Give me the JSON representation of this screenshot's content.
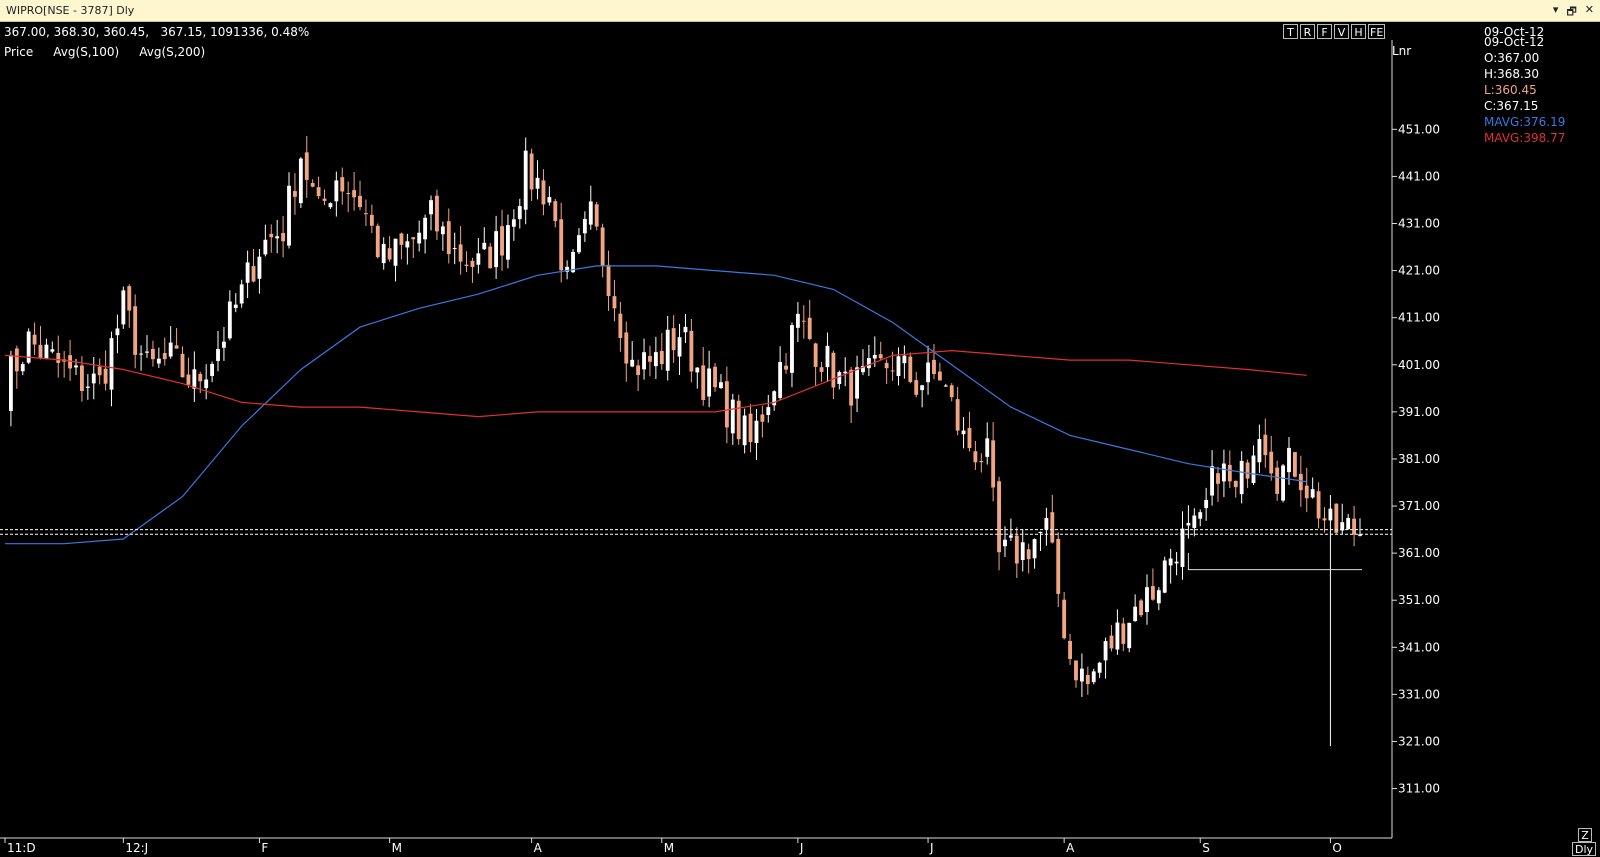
{
  "window": {
    "title": "WIPRO[NSE - 3787] Dly",
    "controls": [
      "▾",
      "🗗",
      "✕"
    ]
  },
  "header": {
    "info": "367.00, 368.30, 360.45,   367.15, 1091336, 0.48%",
    "legend": [
      "Price",
      "Avg(S,100)",
      "Avg(S,200)"
    ],
    "tool_buttons": [
      "T",
      "R",
      "F",
      "V",
      "H",
      "FE"
    ],
    "scale_type": "Lnr"
  },
  "readout": {
    "date1": "09-Oct-12",
    "date2": "09-Oct-12",
    "open": "O:367.00",
    "high": "H:368.30",
    "low": "L:360.45",
    "close": "C:367.15",
    "mavg1": "MAVG:376.19",
    "mavg2": "MAVG:398.77",
    "colors": {
      "low": "#f2a583",
      "mavg1": "#3a78e0",
      "mavg2": "#e03030"
    }
  },
  "corner": {
    "zoom": "Z",
    "period": "Dly"
  },
  "chart_data": {
    "type": "candlestick",
    "y_ticks": [
      451,
      441,
      431,
      421,
      411,
      401,
      391,
      381,
      371,
      361,
      351,
      341,
      331,
      321,
      311
    ],
    "y_tick_labels": [
      "451.00",
      "441.00",
      "431.00",
      "421.00",
      "411.00",
      "401.00",
      "391.00",
      "381.00",
      "371.00",
      "361.00",
      "351.00",
      "341.00",
      "331.00",
      "321.00",
      "311.00"
    ],
    "ylim": [
      300.5,
      463.6
    ],
    "x_labels": [
      "11:D",
      "12:J",
      "F",
      "M",
      "A",
      "M",
      "J",
      "J",
      "A",
      "S",
      "O"
    ],
    "x_label_index": [
      0,
      20,
      43,
      65,
      89,
      111,
      134,
      156,
      179,
      202,
      224
    ],
    "num_bars": 230,
    "close_anchors": [
      [
        0,
        397
      ],
      [
        4,
        406
      ],
      [
        8,
        402
      ],
      [
        12,
        398
      ],
      [
        16,
        397
      ],
      [
        20,
        413
      ],
      [
        24,
        400
      ],
      [
        28,
        402
      ],
      [
        32,
        397
      ],
      [
        36,
        405
      ],
      [
        40,
        416
      ],
      [
        43,
        426
      ],
      [
        47,
        430
      ],
      [
        50,
        446
      ],
      [
        53,
        433
      ],
      [
        56,
        441
      ],
      [
        60,
        436
      ],
      [
        64,
        423
      ],
      [
        68,
        426
      ],
      [
        72,
        432
      ],
      [
        76,
        425
      ],
      [
        80,
        422
      ],
      [
        84,
        428
      ],
      [
        88,
        442
      ],
      [
        92,
        437
      ],
      [
        95,
        418
      ],
      [
        99,
        432
      ],
      [
        102,
        420
      ],
      [
        106,
        401
      ],
      [
        110,
        402
      ],
      [
        114,
        408
      ],
      [
        118,
        398
      ],
      [
        122,
        392
      ],
      [
        126,
        384
      ],
      [
        130,
        398
      ],
      [
        134,
        410
      ],
      [
        138,
        403
      ],
      [
        142,
        396
      ],
      [
        146,
        398
      ],
      [
        150,
        402
      ],
      [
        154,
        397
      ],
      [
        158,
        399
      ],
      [
        162,
        385
      ],
      [
        166,
        381
      ],
      [
        168,
        360
      ],
      [
        172,
        362
      ],
      [
        176,
        366
      ],
      [
        180,
        339
      ],
      [
        183,
        333
      ],
      [
        186,
        340
      ],
      [
        190,
        348
      ],
      [
        194,
        353
      ],
      [
        198,
        363
      ],
      [
        202,
        366
      ],
      [
        205,
        380
      ],
      [
        208,
        373
      ],
      [
        212,
        389
      ],
      [
        215,
        378
      ],
      [
        218,
        380
      ],
      [
        221,
        373
      ],
      [
        224,
        366
      ],
      [
        227,
        366
      ]
    ],
    "low_wick_index": 224,
    "low_wick_value": 320,
    "series": [
      {
        "name": "Avg(S,100)",
        "color": "#3a78e0",
        "points": [
          [
            0,
            363
          ],
          [
            10,
            363
          ],
          [
            20,
            364
          ],
          [
            30,
            373
          ],
          [
            40,
            388
          ],
          [
            50,
            400
          ],
          [
            60,
            409
          ],
          [
            70,
            413
          ],
          [
            80,
            416
          ],
          [
            90,
            420
          ],
          [
            100,
            422
          ],
          [
            110,
            422
          ],
          [
            120,
            421
          ],
          [
            130,
            420
          ],
          [
            140,
            417
          ],
          [
            150,
            410
          ],
          [
            160,
            401
          ],
          [
            170,
            392
          ],
          [
            180,
            386
          ],
          [
            190,
            383
          ],
          [
            200,
            380
          ],
          [
            210,
            378
          ],
          [
            220,
            376.19
          ]
        ]
      },
      {
        "name": "Avg(S,200)",
        "color": "#e03030",
        "points": [
          [
            0,
            403
          ],
          [
            10,
            402
          ],
          [
            20,
            400
          ],
          [
            30,
            397
          ],
          [
            40,
            393
          ],
          [
            50,
            392
          ],
          [
            60,
            392
          ],
          [
            70,
            391
          ],
          [
            80,
            390
          ],
          [
            90,
            391
          ],
          [
            100,
            391
          ],
          [
            110,
            391
          ],
          [
            120,
            391
          ],
          [
            130,
            393
          ],
          [
            140,
            398
          ],
          [
            150,
            403
          ],
          [
            160,
            404
          ],
          [
            170,
            403
          ],
          [
            180,
            402
          ],
          [
            190,
            402
          ],
          [
            200,
            401
          ],
          [
            210,
            400
          ],
          [
            220,
            398.77
          ]
        ]
      }
    ],
    "hlines": [
      366,
      365
    ],
    "axis": {
      "bg": "#000000",
      "text": "#ffffff"
    }
  }
}
